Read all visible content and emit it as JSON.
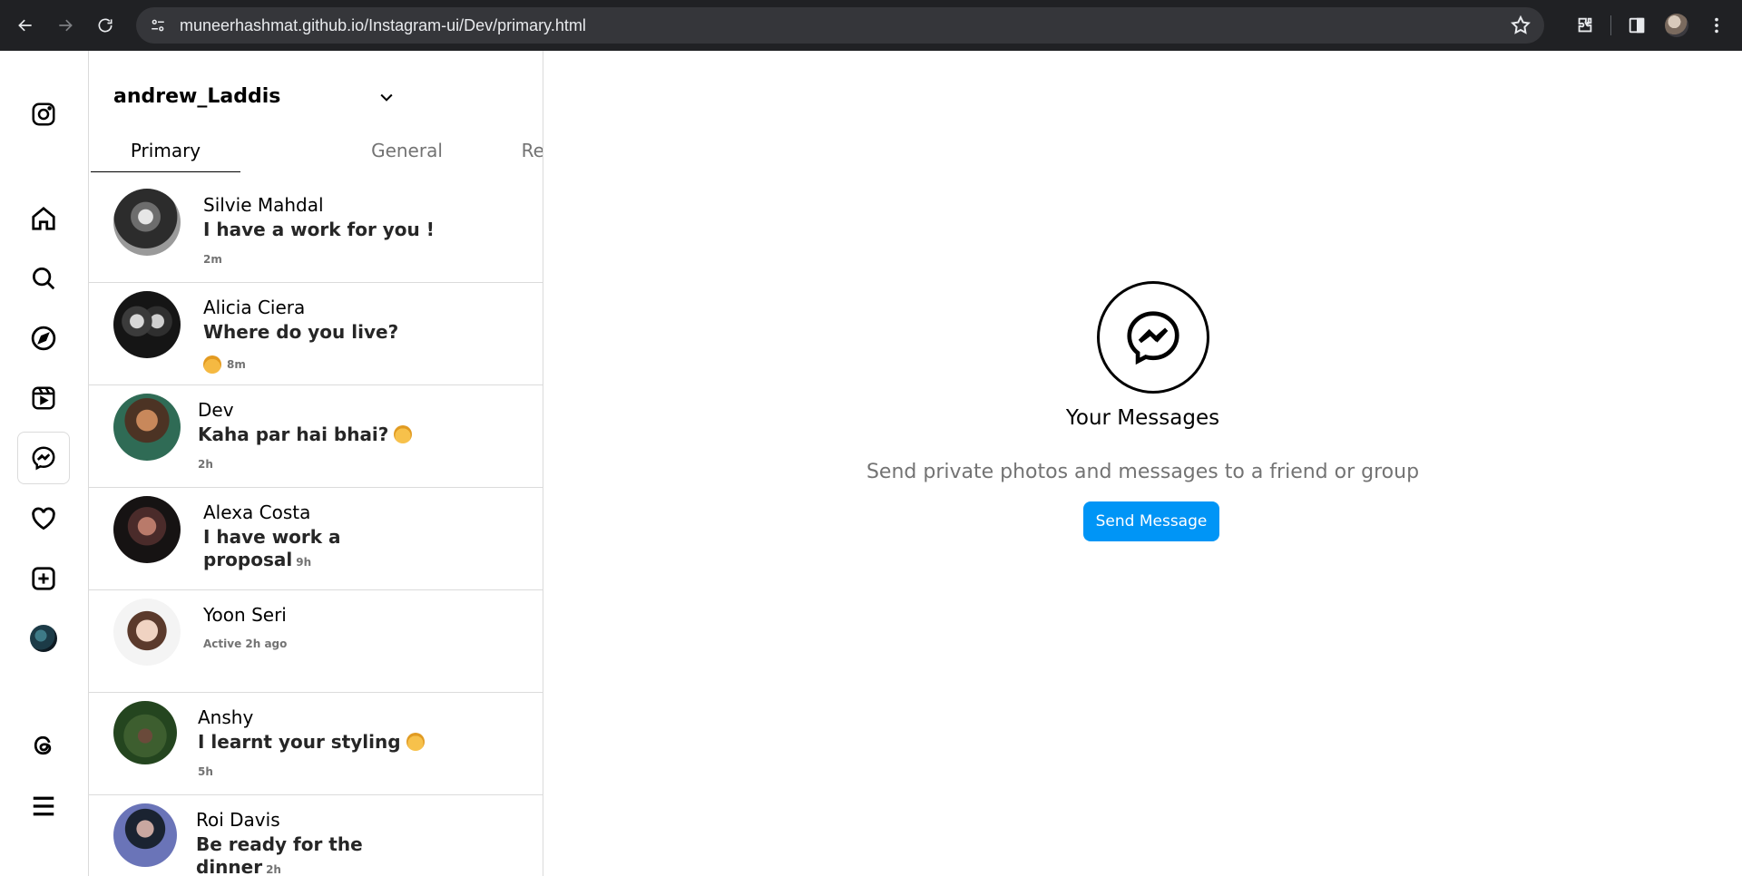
{
  "browser": {
    "url": "muneerhashmat.github.io/Instagram-ui/Dev/primary.html"
  },
  "rail": {
    "items": [
      {
        "name": "instagram-logo-icon"
      },
      {
        "name": "home-icon"
      },
      {
        "name": "search-icon"
      },
      {
        "name": "explore-icon"
      },
      {
        "name": "reels-icon"
      },
      {
        "name": "messenger-icon"
      },
      {
        "name": "heart-icon"
      },
      {
        "name": "create-icon"
      },
      {
        "name": "profile-avatar"
      },
      {
        "name": "threads-icon"
      },
      {
        "name": "menu-icon"
      }
    ]
  },
  "inbox": {
    "username": "andrew_Laddis",
    "tabs": [
      "Primary",
      "General",
      "Requests"
    ],
    "conversations": [
      {
        "name": "Silvie Mahdal",
        "message": "I have a work for you !",
        "time": "2m"
      },
      {
        "name": "Alicia Ciera",
        "message": "Where do you live?",
        "time": "8m"
      },
      {
        "name": "Dev",
        "message": "Kaha par hai bhai?",
        "time": "2h"
      },
      {
        "name": "Alexa Costa",
        "message": "I have work a proposal",
        "time": "9h"
      },
      {
        "name": "Yoon Seri",
        "message": "",
        "time": "Active 2h ago"
      },
      {
        "name": "Anshy",
        "message": "I learnt your styling",
        "time": "5h"
      },
      {
        "name": "Roi Davis",
        "message": "Be ready for the dinner",
        "time": "2h"
      }
    ]
  },
  "empty": {
    "title": "Your Messages",
    "subtitle": "Send private photos and messages to a friend or group",
    "button": "Send Message"
  },
  "colors": {
    "accent": "#0095f6",
    "chrome": "#202124"
  }
}
